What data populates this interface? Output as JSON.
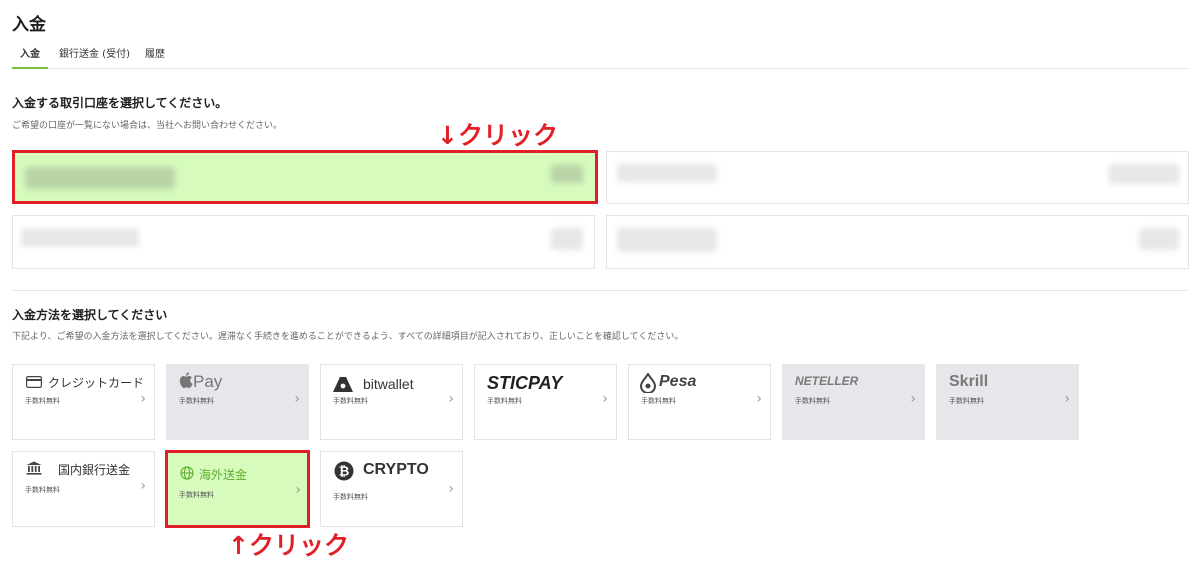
{
  "page": {
    "title": "入金"
  },
  "tabs": [
    {
      "label": "入金"
    },
    {
      "label": "銀行送金 (受付)"
    },
    {
      "label": "履歴"
    }
  ],
  "accounts_section": {
    "title": "入金する取引口座を選択してください。",
    "description": "ご希望の口座が一覧にない場合は、当社へお問い合わせください。"
  },
  "methods_section": {
    "title": "入金方法を選択してください",
    "description": "下記より、ご希望の入金方法を選択してください。遅滞なく手続きを進めることができるよう、すべての詳細項目が記入されており、正しいことを確認してください。"
  },
  "methods": [
    {
      "label": "クレジットカード",
      "fee": "手数料無料",
      "icon": "credit-card-icon"
    },
    {
      "label": "Pay",
      "fee": "手数料無料",
      "icon": "apple-icon"
    },
    {
      "label": "bitwallet",
      "fee": "手数料無料",
      "icon": "bitwallet-icon"
    },
    {
      "label": "STICPAY",
      "fee": "手数料無料"
    },
    {
      "label": "Pesa",
      "fee": "手数料無料",
      "icon": "pesa-icon"
    },
    {
      "label": "NETELLER",
      "fee": "手数料無料"
    },
    {
      "label": "Skrill",
      "fee": "手数料無料"
    },
    {
      "label": "国内銀行送金",
      "fee": "手数料無料",
      "icon": "bank-icon"
    },
    {
      "label": "海外送金",
      "fee": "手数料無料",
      "icon": "globe-icon"
    },
    {
      "label": "CRYPTO",
      "fee": "手数料無料",
      "icon": "bitcoin-icon"
    }
  ],
  "annotations": {
    "top": "↓クリック",
    "bottom": "↑クリック",
    "color": "#e01f26"
  },
  "colors": {
    "accent": "#7cc243",
    "highlight_bg": "#d6fbbd",
    "disabled_bg": "#e6e7ea"
  }
}
